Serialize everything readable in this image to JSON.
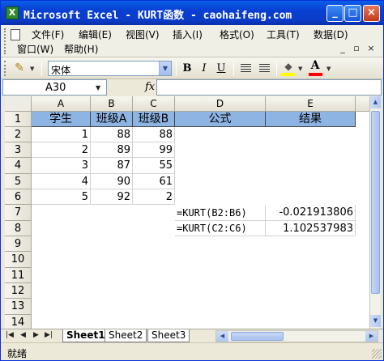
{
  "window": {
    "title": "Microsoft Excel - KURT函数 - caohaifeng.com",
    "minimize": "_",
    "maximize": "□",
    "close": "×"
  },
  "menu": {
    "items": [
      "文件(F)",
      "编辑(E)",
      "视图(V)",
      "插入(I)",
      "格式(O)",
      "工具(T)",
      "数据(D)",
      "窗口(W)",
      "帮助(H)"
    ],
    "mdi_minimize": "_",
    "mdi_restore": "▫",
    "mdi_close": "×"
  },
  "toolbar": {
    "font_name": "宋体",
    "bold": "B",
    "italic": "I",
    "underline": "U",
    "font_color_glyph": "A",
    "fill_color": "#ffff00",
    "font_color": "#ff0000"
  },
  "formula_bar": {
    "name_box": "A30",
    "fx": "fx",
    "formula": ""
  },
  "columns": [
    "A",
    "B",
    "C",
    "D",
    "E"
  ],
  "rows": [
    "1",
    "2",
    "3",
    "4",
    "5",
    "6",
    "7",
    "8",
    "9",
    "10",
    "11",
    "12",
    "13",
    "14"
  ],
  "cells": {
    "header": [
      "学生",
      "班级A",
      "班级B",
      "公式",
      "结果"
    ],
    "data": [
      {
        "a": "1",
        "b": "88",
        "c": "88"
      },
      {
        "a": "2",
        "b": "89",
        "c": "99"
      },
      {
        "a": "3",
        "b": "87",
        "c": "55"
      },
      {
        "a": "4",
        "b": "90",
        "c": "61"
      },
      {
        "a": "5",
        "b": "92",
        "c": "2"
      }
    ],
    "formulas": [
      {
        "d": "=KURT(B2:B6)",
        "e": "-0.021913806"
      },
      {
        "d": "=KURT(C2:C6)",
        "e": "1.102537983"
      }
    ]
  },
  "header_fill_color": "#8db4e2",
  "sheet_tabs": [
    "Sheet1",
    "Sheet2",
    "Sheet3"
  ],
  "status": "就绪"
}
